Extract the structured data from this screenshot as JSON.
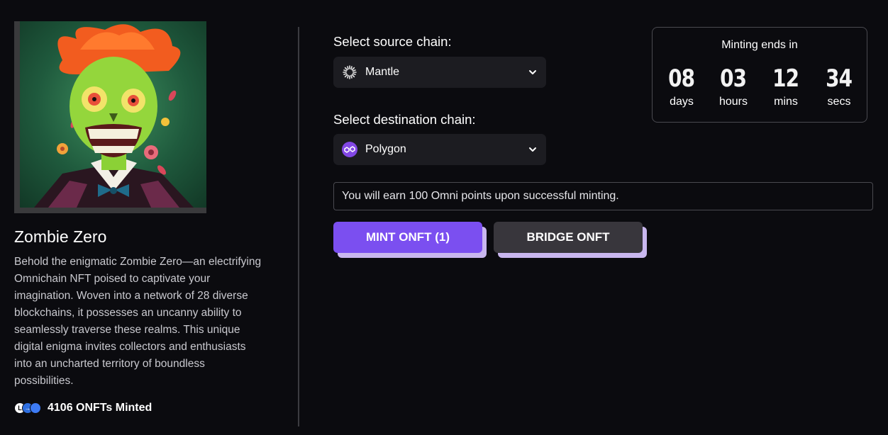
{
  "nft": {
    "title": "Zombie Zero",
    "description": "Behold the enigmatic Zombie Zero—an electrifying Omnichain NFT poised to captivate your imagination. Woven into a network of 28 diverse blockchains, it possesses an uncanny ability to seamlessly traverse these realms. This unique digital enigma invites collectors and enthusiasts into an uncharted territory of boundless possibilities.",
    "minted_text": "4106 ONFTs Minted",
    "chain_badges": [
      "L",
      "→",
      ""
    ]
  },
  "source": {
    "label": "Select source chain:",
    "value": "Mantle",
    "icon": "mantle-icon"
  },
  "destination": {
    "label": "Select destination chain:",
    "value": "Polygon",
    "icon": "polygon-icon"
  },
  "countdown": {
    "title": "Minting ends in",
    "days": "08",
    "days_label": "days",
    "hours": "03",
    "hours_label": "hours",
    "mins": "12",
    "mins_label": "mins",
    "secs": "34",
    "secs_label": "secs"
  },
  "info": {
    "message": "You will earn 100 Omni points upon successful minting."
  },
  "actions": {
    "mint_label": "MINT ONFT (1)",
    "bridge_label": "BRIDGE ONFT"
  },
  "colors": {
    "background": "#0b0b0f",
    "accent": "#7b4ff0",
    "accent_shadow": "#c9b7ef",
    "polygon": "#8247e5"
  }
}
